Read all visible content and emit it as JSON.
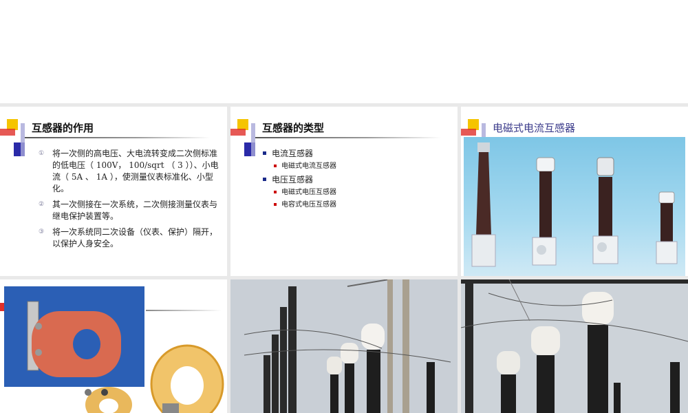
{
  "slides": {
    "s1": {
      "title": "互感器的作用",
      "items": [
        {
          "num": "①",
          "text": "将一次侧的高电压、大电流转变成二次侧标准的低电压（ 100V， 100/sqrt （ 3 ））、小电流（ 5A 、 1A ），使测量仪表标准化、小型化。"
        },
        {
          "num": "②",
          "text": "其一次侧接在一次系统，二次侧接测量仪表与继电保护装置等。"
        },
        {
          "num": "③",
          "text": "将一次系统同二次设备（仪表、保护）隔开，以保护人身安全。"
        }
      ]
    },
    "s2": {
      "title": "互感器的类型",
      "groups": [
        {
          "label": "电流互感器",
          "subs": [
            "电磁式电流互感器"
          ]
        },
        {
          "label": "电压互感器",
          "subs": [
            "电磁式电压互感器",
            "电容式电压互感器"
          ]
        }
      ]
    },
    "s3": {
      "title": "电磁式电流互感器"
    },
    "colors": {
      "deco_yellow": "#f5c400",
      "deco_red": "#e0302a",
      "deco_blue": "#2a2aa8",
      "title3": "#3a3a8a",
      "bullet_l1": "#1a2a8a",
      "bullet_l2": "#cc0000"
    }
  }
}
